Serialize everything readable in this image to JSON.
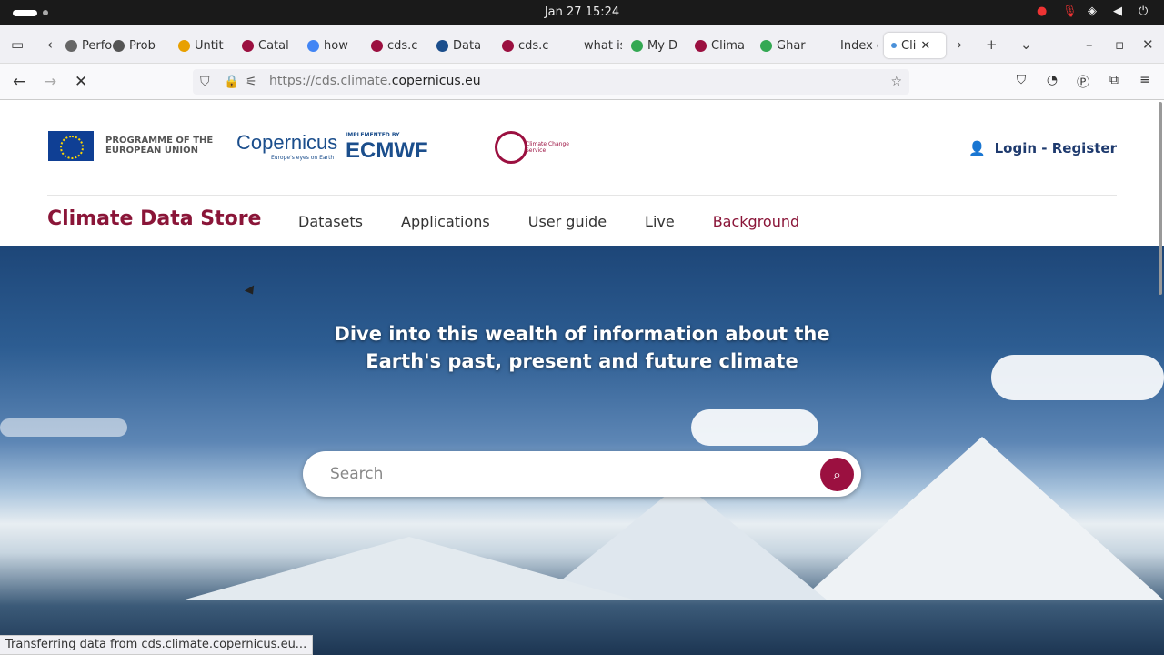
{
  "os": {
    "clock": "Jan 27  15:24"
  },
  "browser": {
    "tabs": [
      {
        "label": "Perfo",
        "color": "#666"
      },
      {
        "label": "Prob",
        "color": "#555"
      },
      {
        "label": "Untit",
        "color": "#e8a000"
      },
      {
        "label": "Catal",
        "color": "#9b1040"
      },
      {
        "label": "how",
        "color": "#4285f4"
      },
      {
        "label": "cds.c",
        "color": "#9b1040"
      },
      {
        "label": "Data",
        "color": "#1b4e8c"
      },
      {
        "label": "cds.c",
        "color": "#9b1040"
      },
      {
        "label": "what is r",
        "color": "#f0f0f4"
      },
      {
        "label": "My D",
        "color": "#34a853"
      },
      {
        "label": "Clima",
        "color": "#9b1040"
      },
      {
        "label": "Ghar",
        "color": "#34a853"
      },
      {
        "label": "Index of",
        "color": "#f0f0f4"
      }
    ],
    "active_tab": "Cli",
    "url_prefix": "https://cds.climate.",
    "url_domain": "copernicus.eu"
  },
  "header": {
    "eu_text": "PROGRAMME OF THE EUROPEAN UNION",
    "copernicus": "opernicus",
    "copernicus_sub": "Europe's eyes on Earth",
    "ecmwf_small": "IMPLEMENTED BY",
    "ecmwf": "ECMWF",
    "c3s": "Climate Change Service",
    "login": "Login - Register"
  },
  "nav": {
    "brand": "Climate Data Store",
    "items": [
      "Datasets",
      "Applications",
      "User guide",
      "Live",
      "Background"
    ]
  },
  "hero": {
    "title": "Dive into this wealth of information about the Earth's past, present and future climate",
    "search_placeholder": "Search"
  },
  "status": "Transferring data from cds.climate.copernicus.eu..."
}
